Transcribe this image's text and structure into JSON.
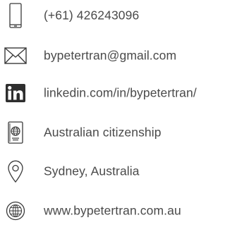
{
  "colors": {
    "text": "#4a4a4a",
    "icon": "#3a3a3a",
    "linkedin_badge": "#2e2e2e"
  },
  "contacts": [
    {
      "icon": "smartphone-icon",
      "text": "(+61) 426243096"
    },
    {
      "icon": "envelope-icon",
      "text": "bypetertran@gmail.com"
    },
    {
      "icon": "linkedin-icon",
      "icon_text": "in",
      "text": "linkedin.com/in/bypetertran/"
    },
    {
      "icon": "passport-icon",
      "text": "Australian citizenship"
    },
    {
      "icon": "map-pin-icon",
      "text": "Sydney, Australia"
    },
    {
      "icon": "globe-icon",
      "text": "www.bypetertran.com.au"
    }
  ]
}
